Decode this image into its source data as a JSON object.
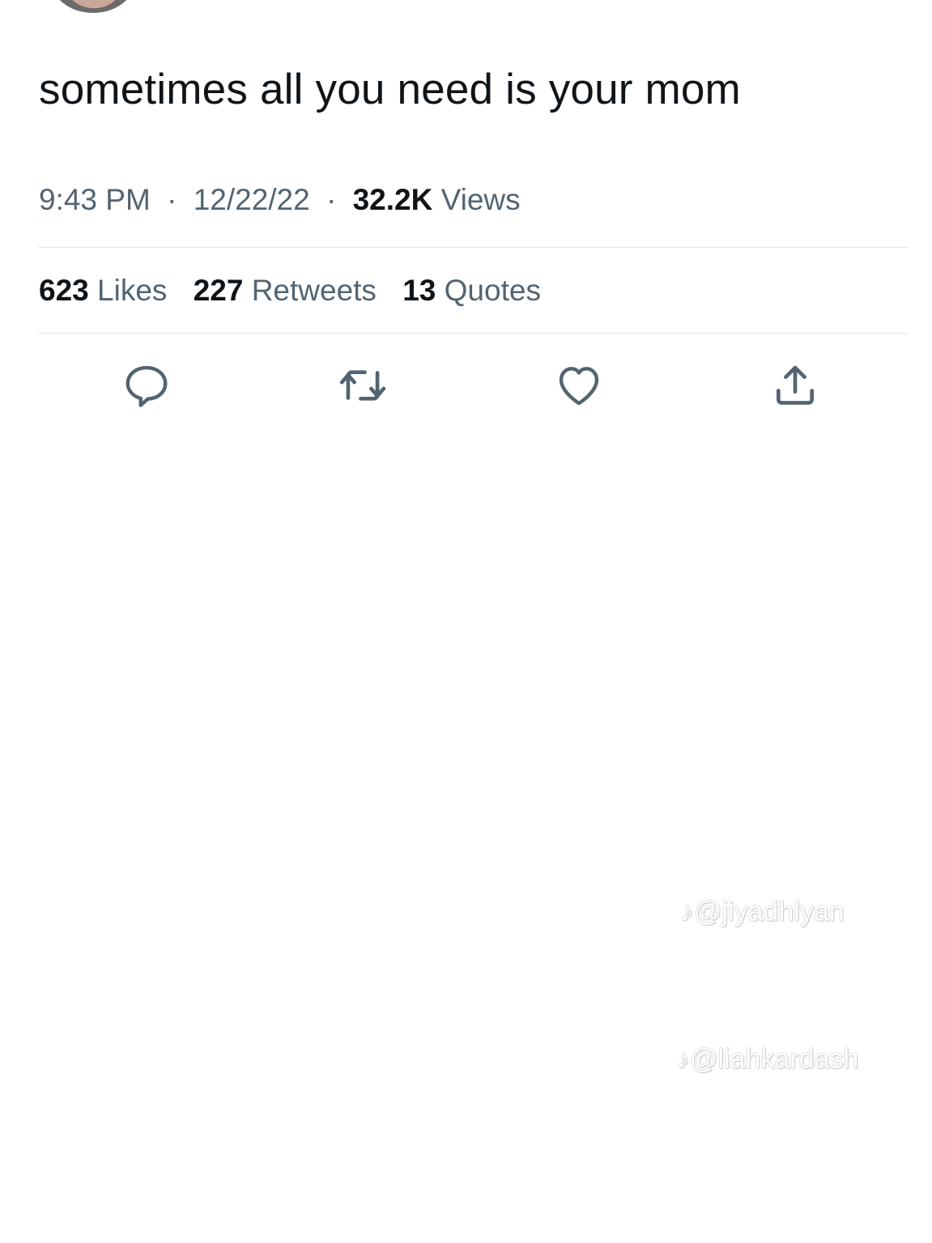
{
  "tweet": {
    "text": "sometimes all you need is your mom",
    "time": "9:43 PM",
    "separator": "·",
    "date": "12/22/22",
    "views_count": "32.2K",
    "views_label": "Views"
  },
  "stats": [
    {
      "count": "623",
      "label": "Likes"
    },
    {
      "count": "227",
      "label": "Retweets"
    },
    {
      "count": "13",
      "label": "Quotes"
    }
  ],
  "actions": {
    "icons": [
      "reply-icon",
      "retweet-icon",
      "like-icon",
      "share-icon"
    ],
    "icon_color": "#536471"
  },
  "watermarks": [
    {
      "icon": "tiktok-icon",
      "handle": "@jiyadhlyan"
    },
    {
      "icon": "tiktok-icon",
      "handle": "@liahkardash"
    }
  ],
  "colors": {
    "text_primary": "#0f1419",
    "text_secondary": "#536471",
    "divider": "#e2e6e9",
    "background": "#ffffff"
  }
}
